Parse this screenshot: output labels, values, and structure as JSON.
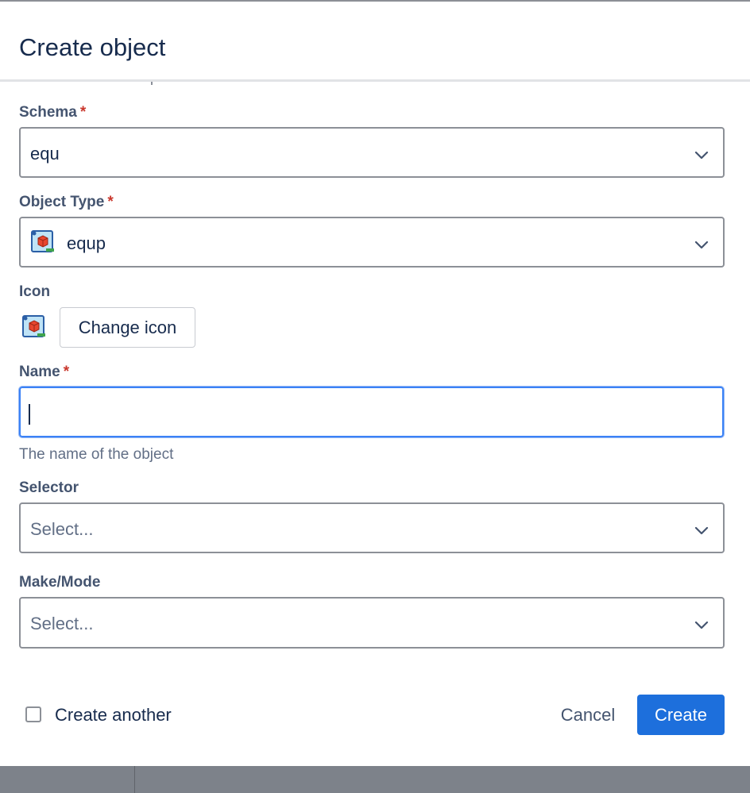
{
  "dialog": {
    "title": "Create object"
  },
  "schema": {
    "label": "Schema",
    "required_mark": "*",
    "value": "equ"
  },
  "object_type": {
    "label": "Object Type",
    "required_mark": "*",
    "value": "equp",
    "icon": "object-type-cube-icon"
  },
  "icon_section": {
    "label": "Icon",
    "button_label": "Change icon",
    "icon": "object-type-cube-icon"
  },
  "name": {
    "label": "Name",
    "required_mark": "*",
    "value": "",
    "helper": "The name of the object"
  },
  "selector": {
    "label": "Selector",
    "placeholder": "Select..."
  },
  "make_mode": {
    "label": "Make/Mode",
    "placeholder": "Select..."
  },
  "footer": {
    "create_another_label": "Create another",
    "create_another_checked": false,
    "cancel_label": "Cancel",
    "create_label": "Create"
  },
  "colors": {
    "primary": "#1d6fdc",
    "focus_border": "#3b82f6",
    "required": "#c9372c",
    "label": "#44546f"
  }
}
